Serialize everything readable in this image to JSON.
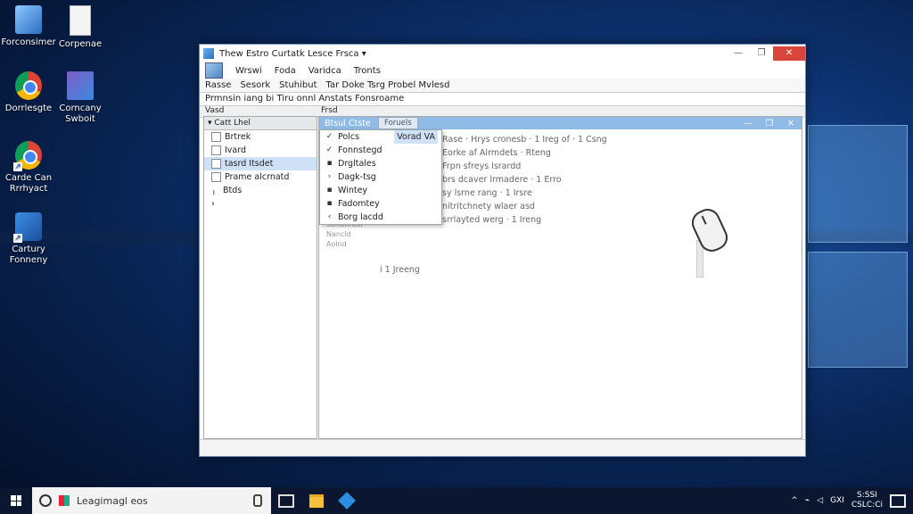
{
  "desktop": {
    "icons": [
      {
        "label": "Forconsimer"
      },
      {
        "label": "Corpenae"
      },
      {
        "label": "Dorrlesgte"
      },
      {
        "label": "Corncany Swboit"
      },
      {
        "label": "Carde Can Rrrhyact"
      },
      {
        "label": "Cartury Fonneny"
      }
    ]
  },
  "window": {
    "title": "Thew Estro Curtatk Lesce Frsca ▾",
    "controls": {
      "minimize": "—",
      "maximize": "❐",
      "close": "✕"
    },
    "menu": [
      "Wrswi",
      "Foda",
      "Varidca",
      "Tronts"
    ],
    "toolbar": [
      "Rasse",
      "Sesork",
      "Stuhibut",
      "Tar Doke Tsrg Probel Mvlesd"
    ],
    "path": "Prmnsin iang bi Tiru onnl Anstats Fonsroame",
    "col_left": "Vasd",
    "col_right": "Frsd"
  },
  "tree": {
    "header": "Catt Lhel",
    "items": [
      "Brtrek",
      "Ivard",
      "tasrd Itsdet",
      "Prame alcrnatd",
      "Btds"
    ]
  },
  "inner": {
    "title": "Btsul Ctste",
    "tooltip": "Foruels",
    "buttons": {
      "min": "—",
      "max": "❐",
      "close": "✕"
    }
  },
  "dropdown": {
    "items": [
      {
        "mark": "✓",
        "label": "Polcs"
      },
      {
        "mark": "✓",
        "label": "Fonnstegd"
      },
      {
        "mark": "▪",
        "label": "Drgltales"
      },
      {
        "mark": "›",
        "label": "Dagk-tsg"
      },
      {
        "mark": "▪",
        "label": "Wintey"
      },
      {
        "mark": "▪",
        "label": "Fadomtey"
      },
      {
        "mark": "‹",
        "label": "Borg lacdd"
      }
    ],
    "highlight_label": "Vorad VA"
  },
  "list": {
    "rows": [
      "Rase  ·  Hrys cronesb  ·  1 Ireg of  ·  1 Csng",
      "Eorke af Alrmdets  ·  Rteng",
      "Frpn sfreys lsrardd",
      "brs dcaver lrmadere  ·  1 Erro",
      "sy lsrne rang  ·  1 Irsre",
      "nitritchnety wlaer asd",
      "srrlayted werg  ·  1 Ireng"
    ],
    "extra": [
      "Senatlrear",
      "Nancld",
      "Aolnd"
    ],
    "lower": "i  1 Jreeng"
  },
  "taskbar": {
    "search_text": "Leagimagl eos",
    "time": "S:SSI",
    "date": "CSLC:Cі",
    "tray_label": "GXI"
  }
}
